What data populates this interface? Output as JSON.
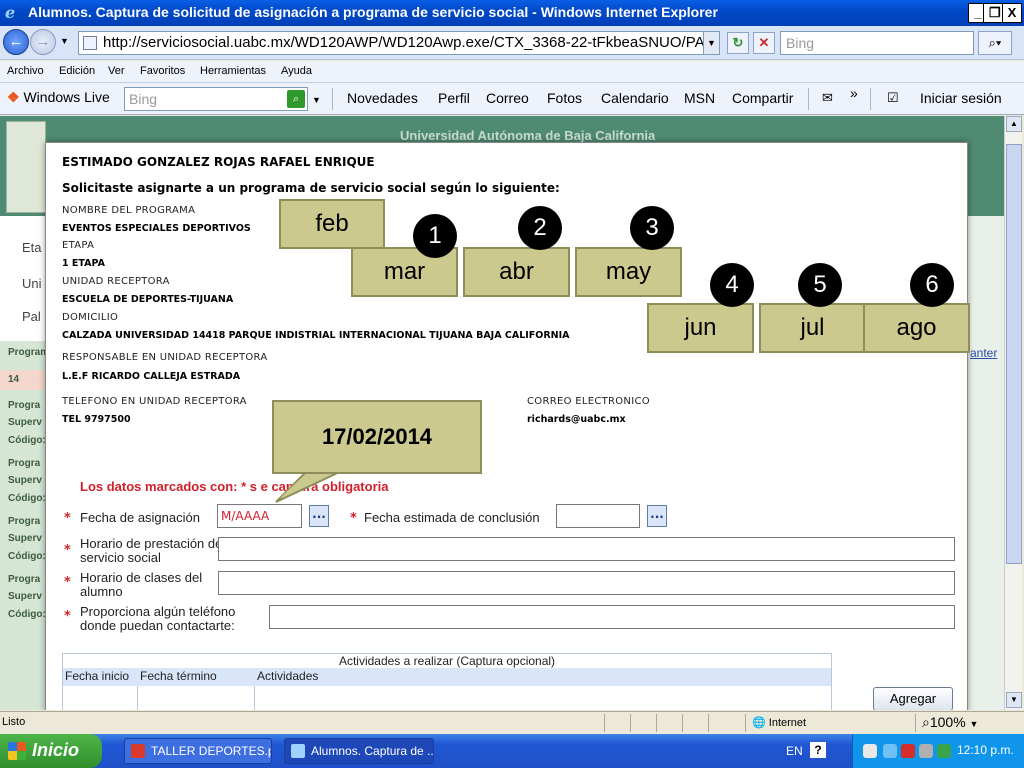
{
  "window": {
    "title": "Alumnos. Captura de solicitud de asignación a programa de servicio social - Windows Internet Explorer",
    "controls": [
      "_",
      " ",
      "X"
    ]
  },
  "address": {
    "url": "http://serviciosocial.uabc.mx/WD120AWP/WD120Awp.exe/CTX_3368-22-tFkbeaSNUO/PAGE",
    "search_placeholder": "Bing"
  },
  "menu": [
    "Archivo",
    "Edición",
    "Ver",
    "Favoritos",
    "Herramientas",
    "Ayuda"
  ],
  "links_toolbar": {
    "brand": "Windows Live",
    "search_placeholder": "Bing",
    "links": [
      "Novedades",
      "Perfil",
      "Correo",
      "Fotos",
      "Calendario",
      "MSN",
      "Compartir"
    ],
    "chevron": "»",
    "signin": "Iniciar sesión"
  },
  "background": {
    "university": "Universidad Autónoma de Baja California",
    "left_labels": [
      "Eta",
      "Uni",
      "Pal"
    ],
    "row_labels": [
      "Program",
      "14",
      "Progra",
      "Superv",
      "Código:",
      "Progra",
      "Superv",
      "Código:",
      "Progra",
      "Superv",
      "Código:",
      "Progra",
      "Superv",
      "Código:"
    ],
    "right_link": "anter"
  },
  "modal": {
    "greeting": "ESTIMADO GONZALEZ ROJAS RAFAEL ENRIQUE",
    "intro": "Solicitaste asignarte a un programa de servicio social según lo siguiente:",
    "fields": [
      {
        "label": "NOMBRE DEL PROGRAMA",
        "value": "EVENTOS ESPECIALES DEPORTIVOS"
      },
      {
        "label": "ETAPA",
        "value": "1 ETAPA"
      },
      {
        "label": "UNIDAD RECEPTORA",
        "value": "ESCUELA DE DEPORTES-TIJUANA"
      },
      {
        "label": "DOMICILIO",
        "value": "CALZADA UNIVERSIDAD 14418 PARQUE INDISTRIAL INTERNACIONAL TIJUANA BAJA CALIFORNIA"
      },
      {
        "label": "RESPONSABLE EN UNIDAD RECEPTORA",
        "value": "L.E.F RICARDO CALLEJA ESTRADA"
      },
      {
        "label": "TELEFONO EN UNIDAD RECEPTORA",
        "value": "TEL 9797500"
      }
    ],
    "email_label": "CORREO ELECTRONICO",
    "email_value": "richards@uabc.mx",
    "mandatory_note": "Los datos marcados con: * s          e captura obligatoria",
    "star": "*",
    "form": {
      "assign_date_label": "Fecha de asignación",
      "assign_date_value": "M/AAAA",
      "end_date_label": "Fecha estimada de conclusión",
      "end_date_value": "",
      "calendar_button": "...",
      "schedule_label": "Horario de prestación de servicio social",
      "class_schedule_label": "Horario de clases del alumno",
      "phone_label": "Proporciona algún teléfono donde puedan contactarte:"
    },
    "activities": {
      "caption": "Actividades a realizar (Captura opcional)",
      "headers": [
        "Fecha inicio",
        "Fecha término",
        "Actividades"
      ]
    },
    "add_button": "Agregar"
  },
  "overlay": {
    "months": [
      "feb",
      "mar",
      "abr",
      "may",
      "jun",
      "jul",
      "ago"
    ],
    "numbers": [
      "1",
      "2",
      "3",
      "4",
      "5",
      "6"
    ],
    "callout": "17/02/2014"
  },
  "statusbar": {
    "text": "Listo",
    "zone": "Internet",
    "zoom": "100%"
  },
  "taskbar": {
    "start": "Inicio",
    "tasks": [
      "TALLER DEPORTES.p...",
      "Alumnos. Captura de ..."
    ],
    "lang": "EN",
    "help": "?",
    "clock": "12:10 p.m."
  }
}
